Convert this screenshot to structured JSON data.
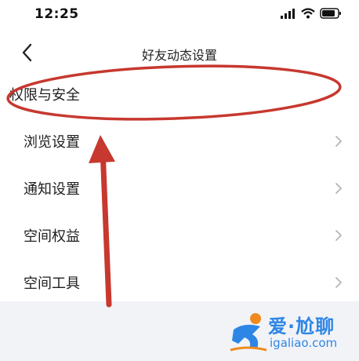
{
  "status_bar": {
    "time": "12:25"
  },
  "nav": {
    "title": "好友动态设置"
  },
  "menu_items": [
    {
      "label": "权限与安全"
    },
    {
      "label": "浏览设置"
    },
    {
      "label": "通知设置"
    },
    {
      "label": "空间权益"
    },
    {
      "label": "空间工具"
    }
  ],
  "watermark": {
    "brand": "爱·尬聊",
    "url": "igaliao.com"
  },
  "colors": {
    "annotation_red": "#c7382f",
    "watermark_blue": "#2d86e6",
    "watermark_orange": "#f08a1c",
    "panel_gray": "#f2f3f7"
  }
}
